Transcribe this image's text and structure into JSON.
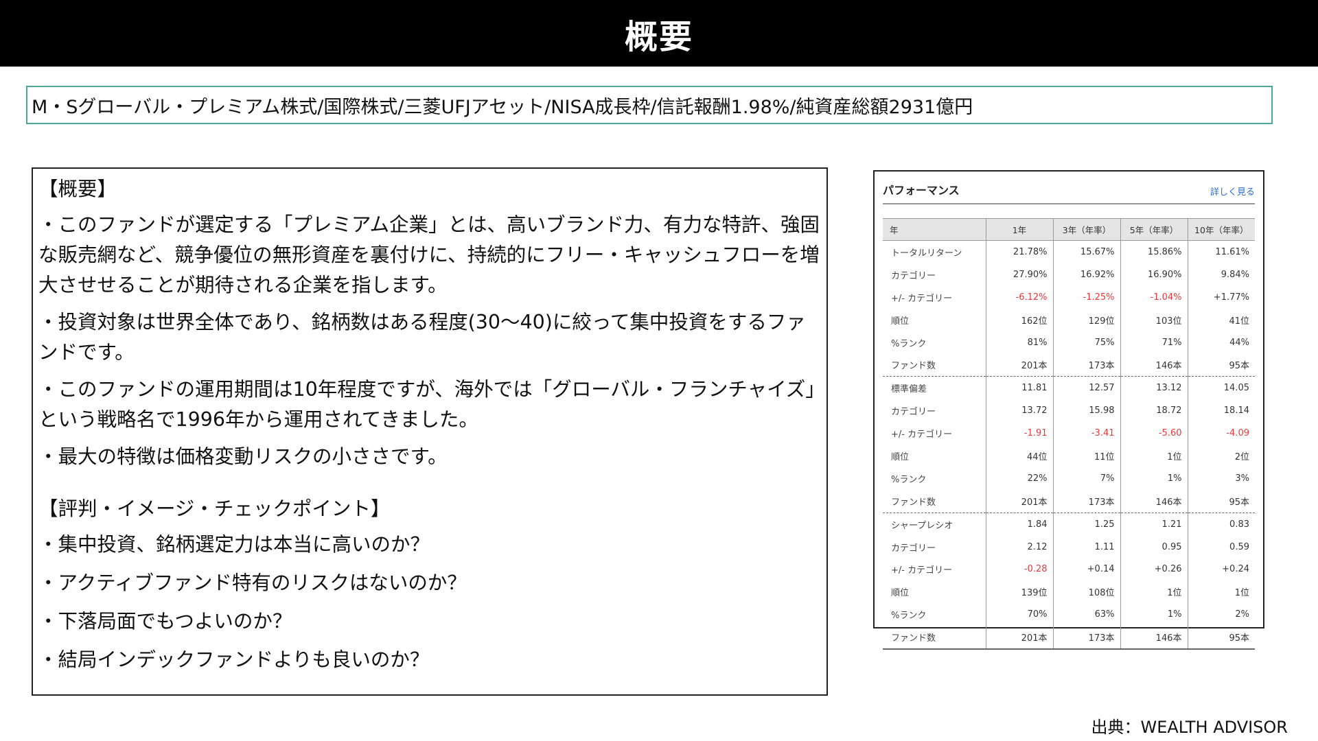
{
  "header": {
    "title": "概要"
  },
  "fund_info": "M・Sグローバル・プレミアム株式/国際株式/三菱UFJアセット/NISA成長枠/信託報酬1.98%/純資産総額2931億円",
  "overview": {
    "heading": "【概要】",
    "paragraphs": [
      "・このファンドが選定する「プレミアム企業」とは、高いブランド力、有力な特許、強固な販売網など、競争優位の無形資産を裏付けに、持続的にフリー・キャッシュフローを増大させせることが期待される企業を指します。",
      "・投資対象は世界全体であり、銘柄数はある程度(30〜40)に絞って集中投資をするファ ンドです。",
      "・このファンドの運用期間は10年程度ですが、海外では「グローバル・フランチャイズ」という戦略名で1996年から運用されてきました。",
      "・最大の特徴は価格変動リスクの小ささです。"
    ],
    "reputation_heading": "【評判・イメージ・チェックポイント】",
    "questions": [
      "・集中投資、銘柄選定力は本当に高いのか？",
      "・アクティブファンド特有のリスクはないのか？",
      "・下落局面でもつよいのか？",
      "・結局インデックファンドよりも良いのか？"
    ]
  },
  "performance": {
    "title": "パフォーマンス",
    "more_link": "詳しく見る",
    "columns": [
      "年",
      "1年",
      "3年（年率）",
      "5年（年率）",
      "10年（年率）"
    ],
    "rows": [
      {
        "label": "トータルリターン",
        "values": [
          "21.78%",
          "15.67%",
          "15.86%",
          "11.61%"
        ],
        "neg": [
          false,
          false,
          false,
          false
        ],
        "sep": false
      },
      {
        "label": "カテゴリー",
        "values": [
          "27.90%",
          "16.92%",
          "16.90%",
          "9.84%"
        ],
        "neg": [
          false,
          false,
          false,
          false
        ],
        "sep": false
      },
      {
        "label": "+/- カテゴリー",
        "values": [
          "-6.12%",
          "-1.25%",
          "-1.04%",
          "+1.77%"
        ],
        "neg": [
          true,
          true,
          true,
          false
        ],
        "sep": false
      },
      {
        "label": "順位",
        "values": [
          "162位",
          "129位",
          "103位",
          "41位"
        ],
        "neg": [
          false,
          false,
          false,
          false
        ],
        "sep": false
      },
      {
        "label": "%ランク",
        "values": [
          "81%",
          "75%",
          "71%",
          "44%"
        ],
        "neg": [
          false,
          false,
          false,
          false
        ],
        "sep": false
      },
      {
        "label": "ファンド数",
        "values": [
          "201本",
          "173本",
          "146本",
          "95本"
        ],
        "neg": [
          false,
          false,
          false,
          false
        ],
        "sep": false
      },
      {
        "label": "標準偏差",
        "values": [
          "11.81",
          "12.57",
          "13.12",
          "14.05"
        ],
        "neg": [
          false,
          false,
          false,
          false
        ],
        "sep": true
      },
      {
        "label": "カテゴリー",
        "values": [
          "13.72",
          "15.98",
          "18.72",
          "18.14"
        ],
        "neg": [
          false,
          false,
          false,
          false
        ],
        "sep": false
      },
      {
        "label": "+/- カテゴリー",
        "values": [
          "-1.91",
          "-3.41",
          "-5.60",
          "-4.09"
        ],
        "neg": [
          true,
          true,
          true,
          true
        ],
        "sep": false
      },
      {
        "label": "順位",
        "values": [
          "44位",
          "11位",
          "1位",
          "2位"
        ],
        "neg": [
          false,
          false,
          false,
          false
        ],
        "sep": false
      },
      {
        "label": "%ランク",
        "values": [
          "22%",
          "7%",
          "1%",
          "3%"
        ],
        "neg": [
          false,
          false,
          false,
          false
        ],
        "sep": false
      },
      {
        "label": "ファンド数",
        "values": [
          "201本",
          "173本",
          "146本",
          "95本"
        ],
        "neg": [
          false,
          false,
          false,
          false
        ],
        "sep": false
      },
      {
        "label": "シャープレシオ",
        "values": [
          "1.84",
          "1.25",
          "1.21",
          "0.83"
        ],
        "neg": [
          false,
          false,
          false,
          false
        ],
        "sep": true
      },
      {
        "label": "カテゴリー",
        "values": [
          "2.12",
          "1.11",
          "0.95",
          "0.59"
        ],
        "neg": [
          false,
          false,
          false,
          false
        ],
        "sep": false
      },
      {
        "label": "+/- カテゴリー",
        "values": [
          "-0.28",
          "+0.14",
          "+0.26",
          "+0.24"
        ],
        "neg": [
          true,
          false,
          false,
          false
        ],
        "sep": false
      },
      {
        "label": "順位",
        "values": [
          "139位",
          "108位",
          "1位",
          "1位"
        ],
        "neg": [
          false,
          false,
          false,
          false
        ],
        "sep": false
      },
      {
        "label": "%ランク",
        "values": [
          "70%",
          "63%",
          "1%",
          "2%"
        ],
        "neg": [
          false,
          false,
          false,
          false
        ],
        "sep": false
      },
      {
        "label": "ファンド数",
        "values": [
          "201本",
          "173本",
          "146本",
          "95本"
        ],
        "neg": [
          false,
          false,
          false,
          false
        ],
        "sep": false
      }
    ]
  },
  "source": "出典：WEALTH ADVISOR",
  "colors": {
    "header_bg": "#000000",
    "accent_border": "#4aa89a",
    "negative": "#e23b3b",
    "link": "#2a6ad6"
  }
}
